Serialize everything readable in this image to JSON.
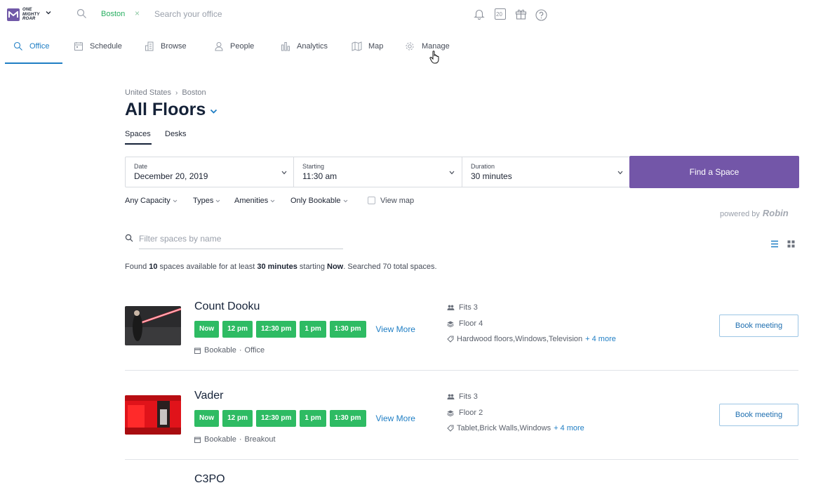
{
  "brand": {
    "logo_text": "ONE\nMIGHTY\nROAR"
  },
  "location": {
    "chip": "Boston",
    "clear": "×",
    "search_placeholder": "Search your office"
  },
  "top_icons": [
    "bell-icon",
    "calendar-icon",
    "gift-icon",
    "help-icon"
  ],
  "calendar_day": "20",
  "nav": {
    "items": [
      {
        "label": "Office",
        "icon": "search-icon",
        "active": true
      },
      {
        "label": "Schedule",
        "icon": "schedule-icon"
      },
      {
        "label": "Browse",
        "icon": "building-icon"
      },
      {
        "label": "People",
        "icon": "person-icon"
      },
      {
        "label": "Analytics",
        "icon": "bar-chart-icon"
      },
      {
        "label": "Map",
        "icon": "map-icon"
      },
      {
        "label": "Manage",
        "icon": "gear-icon"
      }
    ]
  },
  "breadcrumb": {
    "country": "United States",
    "separator": "›",
    "city": "Boston"
  },
  "page_title": "All Floors",
  "subtabs": {
    "spaces": "Spaces",
    "desks": "Desks"
  },
  "filterbar": {
    "date": {
      "label": "Date",
      "value": "December 20, 2019"
    },
    "starting": {
      "label": "Starting",
      "value": "11:30 am"
    },
    "duration": {
      "label": "Duration",
      "value": "30 minutes"
    },
    "find_button": "Find a Space"
  },
  "filters": {
    "capacity": "Any Capacity",
    "types": "Types",
    "amenities": "Amenities",
    "bookable": "Only Bookable",
    "view_map": "View map",
    "view_map_checked": false
  },
  "powered_by": {
    "prefix": "powered by",
    "brand": "Robin"
  },
  "filter_placeholder": "Filter spaces by name",
  "found": {
    "t1": "Found ",
    "count": "10",
    "t2": " spaces available for at least ",
    "duration": "30 minutes",
    "t3": " starting ",
    "start": "Now",
    "t4": ". Searched 70 total spaces."
  },
  "spaces": [
    {
      "name": "Count Dooku",
      "slots": [
        "Now",
        "12 pm",
        "12:30 pm",
        "1 pm",
        "1:30 pm"
      ],
      "view_more": "View More",
      "bookable": "Bookable",
      "sep": "·",
      "type": "Office",
      "fits": "Fits 3",
      "floor": "Floor 4",
      "amenities": "Hardwood floors,Windows,Television",
      "more": "+ 4 more",
      "book": "Book meeting"
    },
    {
      "name": "Vader",
      "slots": [
        "Now",
        "12 pm",
        "12:30 pm",
        "1 pm",
        "1:30 pm"
      ],
      "view_more": "View More",
      "bookable": "Bookable",
      "sep": "·",
      "type": "Breakout",
      "fits": "Fits 3",
      "floor": "Floor 2",
      "amenities": "Tablet,Brick Walls,Windows",
      "more": "+ 4 more",
      "book": "Book meeting"
    },
    {
      "name": "C3PO"
    }
  ],
  "colors": {
    "accent": "#1f7ec4",
    "brand": "#7356a8",
    "slot_green": "#2ebb63",
    "location_green": "#27ae60"
  }
}
